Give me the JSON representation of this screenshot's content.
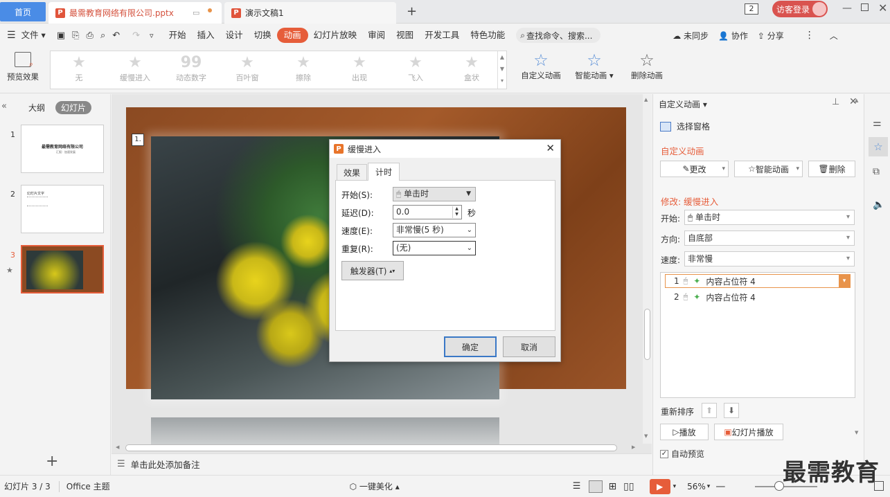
{
  "tabs": {
    "home": "首页",
    "doc1": "最需教育网络有限公司.pptx",
    "doc2": "演示文稿1",
    "page_count_badge": "2",
    "login": "访客登录"
  },
  "menubar": {
    "file": "文件",
    "items": [
      "开始",
      "插入",
      "设计",
      "切换",
      "动画",
      "幻灯片放映",
      "审阅",
      "视图",
      "开发工具",
      "特色功能"
    ],
    "active": "动画",
    "search": "查找命令、搜索...",
    "sync": "未同步",
    "collab": "协作",
    "share": "分享"
  },
  "ribbon": {
    "preview": "预览效果",
    "gallery": [
      "无",
      "缓慢进入",
      "动态数字",
      "百叶窗",
      "擦除",
      "出现",
      "飞入",
      "盒状"
    ],
    "custom": "自定义动画",
    "smart": "智能动画",
    "delete": "删除动画"
  },
  "leftpanel": {
    "outline": "大纲",
    "slides": "幻灯片",
    "thumb1_title": "最需教育网络有限公司",
    "thumb1_sub": "汇报：加速发展",
    "thumb2_title": "幻灯片文字",
    "numbers": [
      "1",
      "2",
      "3"
    ]
  },
  "canvas": {
    "badge": "1"
  },
  "notes": {
    "placeholder": "单击此处添加备注"
  },
  "dialog": {
    "title": "缓慢进入",
    "tab_effect": "效果",
    "tab_timing": "计时",
    "start_label": "开始(S):",
    "start_value": "单击时",
    "delay_label": "延迟(D):",
    "delay_value": "0.0",
    "delay_unit": "秒",
    "speed_label": "速度(E):",
    "speed_value": "非常慢(5 秒)",
    "repeat_label": "重复(R):",
    "repeat_value": "(无)",
    "trigger": "触发器(T)",
    "ok": "确定",
    "cancel": "取消"
  },
  "rightpanel": {
    "header": "自定义动画",
    "selection_pane": "选择窗格",
    "section": "自定义动画",
    "change": "更改",
    "smart": "智能动画",
    "delete": "删除",
    "modify": "修改: 缓慢进入",
    "start_label": "开始:",
    "start_value": "单击时",
    "direction_label": "方向:",
    "direction_value": "自底部",
    "speed_label": "速度:",
    "speed_value": "非常慢",
    "list": [
      {
        "num": "1",
        "name": "内容占位符 4"
      },
      {
        "num": "2",
        "name": "内容占位符 4"
      }
    ],
    "reorder": "重新排序",
    "play": "播放",
    "slideshow": "幻灯片播放",
    "autopreview": "自动预览"
  },
  "statusbar": {
    "slide_info": "幻灯片 3 / 3",
    "theme": "Office 主题",
    "beautify": "一键美化",
    "zoom": "56%"
  },
  "watermark": "最需教育",
  "colors": {
    "accent": "#e65d3a",
    "blue": "#4a8ce6"
  }
}
